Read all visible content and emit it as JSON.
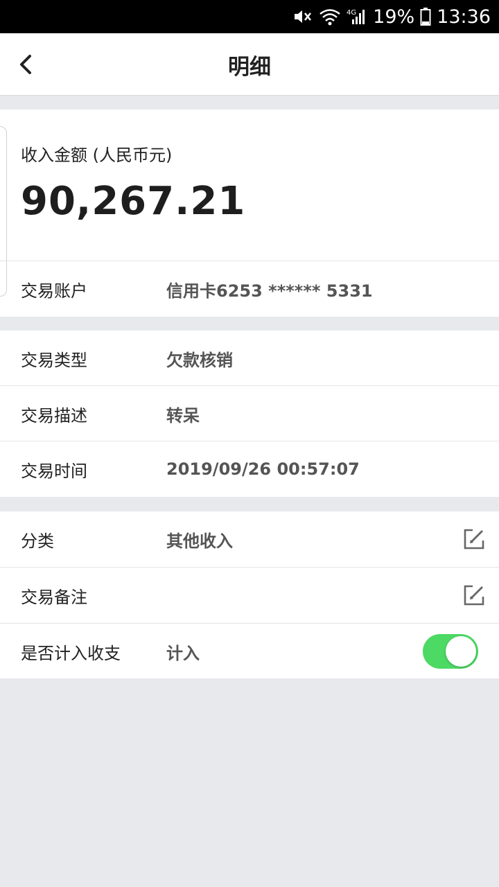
{
  "status_bar": {
    "battery_pct": "19%",
    "time": "13:36",
    "network": "4G",
    "icons": [
      "mute-icon",
      "wifi-icon",
      "signal-icon",
      "battery-icon"
    ]
  },
  "nav": {
    "title": "明细",
    "back_icon": "chevron-left-icon"
  },
  "amount": {
    "label": "收入金额 (人民币元)",
    "value": "90,267.21"
  },
  "account": {
    "label": "交易账户",
    "value": "信用卡6253 ****** 5331"
  },
  "details": [
    {
      "label": "交易类型",
      "value": "欠款核销"
    },
    {
      "label": "交易描述",
      "value": "转呆"
    },
    {
      "label": "交易时间",
      "value": "2019/09/26 00:57:07"
    }
  ],
  "settings": {
    "category": {
      "label": "分类",
      "value": "其他收入"
    },
    "note": {
      "label": "交易备注",
      "value": ""
    },
    "include": {
      "label": "是否计入收支",
      "value": "计入",
      "toggle_on": true
    }
  },
  "colors": {
    "toggle_on": "#4cd964",
    "background": "#e7e9ec"
  }
}
